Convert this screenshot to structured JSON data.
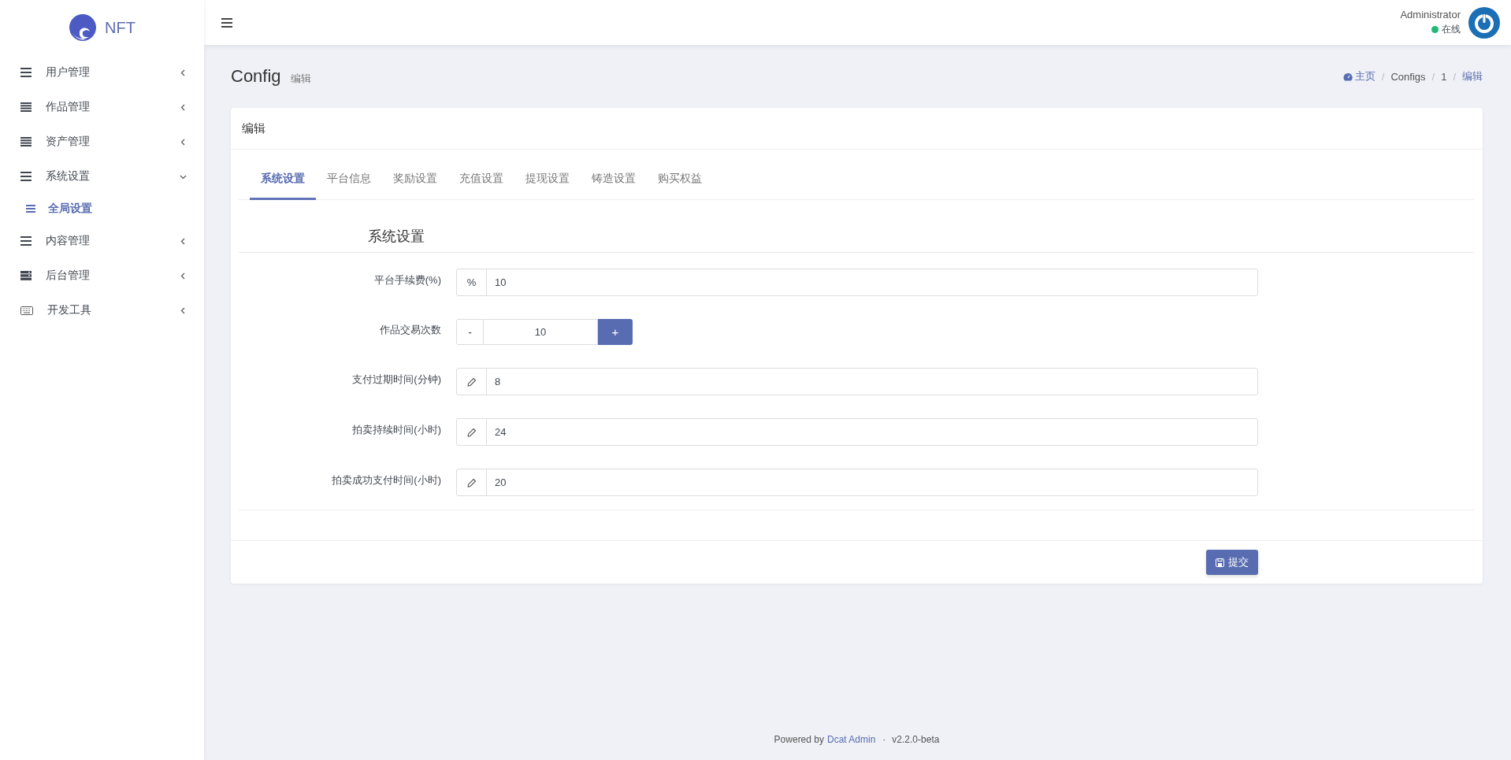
{
  "sidebar": {
    "logo_text": "NFT",
    "items": [
      {
        "label": "用户管理",
        "expanded": false
      },
      {
        "label": "作品管理",
        "expanded": false
      },
      {
        "label": "资产管理",
        "expanded": false
      },
      {
        "label": "系统设置",
        "expanded": true,
        "children": [
          {
            "label": "全局设置",
            "selected": true
          }
        ]
      },
      {
        "label": "内容管理",
        "expanded": false
      },
      {
        "label": "后台管理",
        "expanded": false
      },
      {
        "label": "开发工具",
        "expanded": false
      }
    ]
  },
  "header": {
    "user_name": "Administrator",
    "status": {
      "label": "在线",
      "color": "#21b978"
    }
  },
  "page": {
    "title": "Config",
    "subtitle": "编辑",
    "breadcrumb": {
      "separator": "/",
      "items": [
        {
          "label": "主页",
          "highlighted": true
        },
        {
          "label": "Configs",
          "highlighted": false
        },
        {
          "label": "1",
          "highlighted": false
        },
        {
          "label": "编辑",
          "highlighted": true
        }
      ]
    }
  },
  "card": {
    "title": "编辑",
    "tabs": [
      {
        "label": "系统设置",
        "selected": true
      },
      {
        "label": "平台信息",
        "selected": false
      },
      {
        "label": "奖励设置",
        "selected": false
      },
      {
        "label": "充值设置",
        "selected": false
      },
      {
        "label": "提现设置",
        "selected": false
      },
      {
        "label": "铸造设置",
        "selected": false
      },
      {
        "label": "购买权益",
        "selected": false
      }
    ],
    "section_title": "系统设置",
    "fields": [
      {
        "kind": "prefix",
        "label": "平台手续费(%)",
        "prefix": "%",
        "value": "10"
      },
      {
        "kind": "stepper",
        "label": "作品交易次数",
        "minus": "-",
        "plus": "+",
        "value": "10"
      },
      {
        "kind": "pencil",
        "label": "支付过期时间(分钟)",
        "value": "8"
      },
      {
        "kind": "pencil",
        "label": "拍卖持续时间(小时)",
        "value": "24"
      },
      {
        "kind": "pencil",
        "label": "拍卖成功支付时间(小时)",
        "value": "20"
      }
    ],
    "submit": "提交"
  },
  "footer": {
    "prefix": "Powered by",
    "link": "Dcat Admin",
    "separator": "·",
    "version": "v2.2.0-beta"
  }
}
